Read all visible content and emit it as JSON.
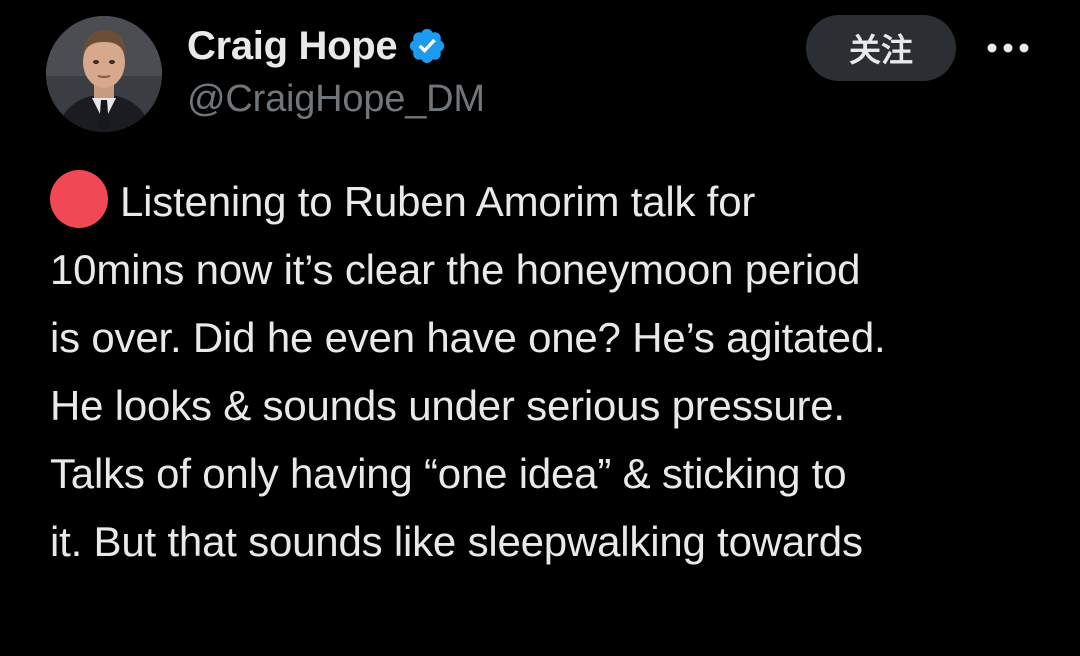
{
  "author": {
    "display_name": "Craig Hope",
    "handle": "@CraigHope_DM",
    "verified_icon": "verified-badge-icon",
    "avatar_icon": "profile-photo"
  },
  "actions": {
    "follow_label": "关注",
    "more_icon": "more-options-icon"
  },
  "tweet": {
    "lead_icon": "red-circle-emoji",
    "lines": [
      "Listening to Ruben Amorim talk for",
      "10mins now it’s clear the honeymoon period",
      "is over. Did he even have one? He’s agitated.",
      "He looks & sounds under serious pressure.",
      "Talks of only having “one idea” & sticking to",
      "it. But that sounds like sleepwalking towards"
    ]
  },
  "colors": {
    "background": "#000000",
    "text_primary": "#e7e9ea",
    "text_secondary": "#71767b",
    "verified_blue": "#1d9bf0",
    "follow_button_bg": "#2b2e32",
    "red_dot": "#f04955"
  }
}
